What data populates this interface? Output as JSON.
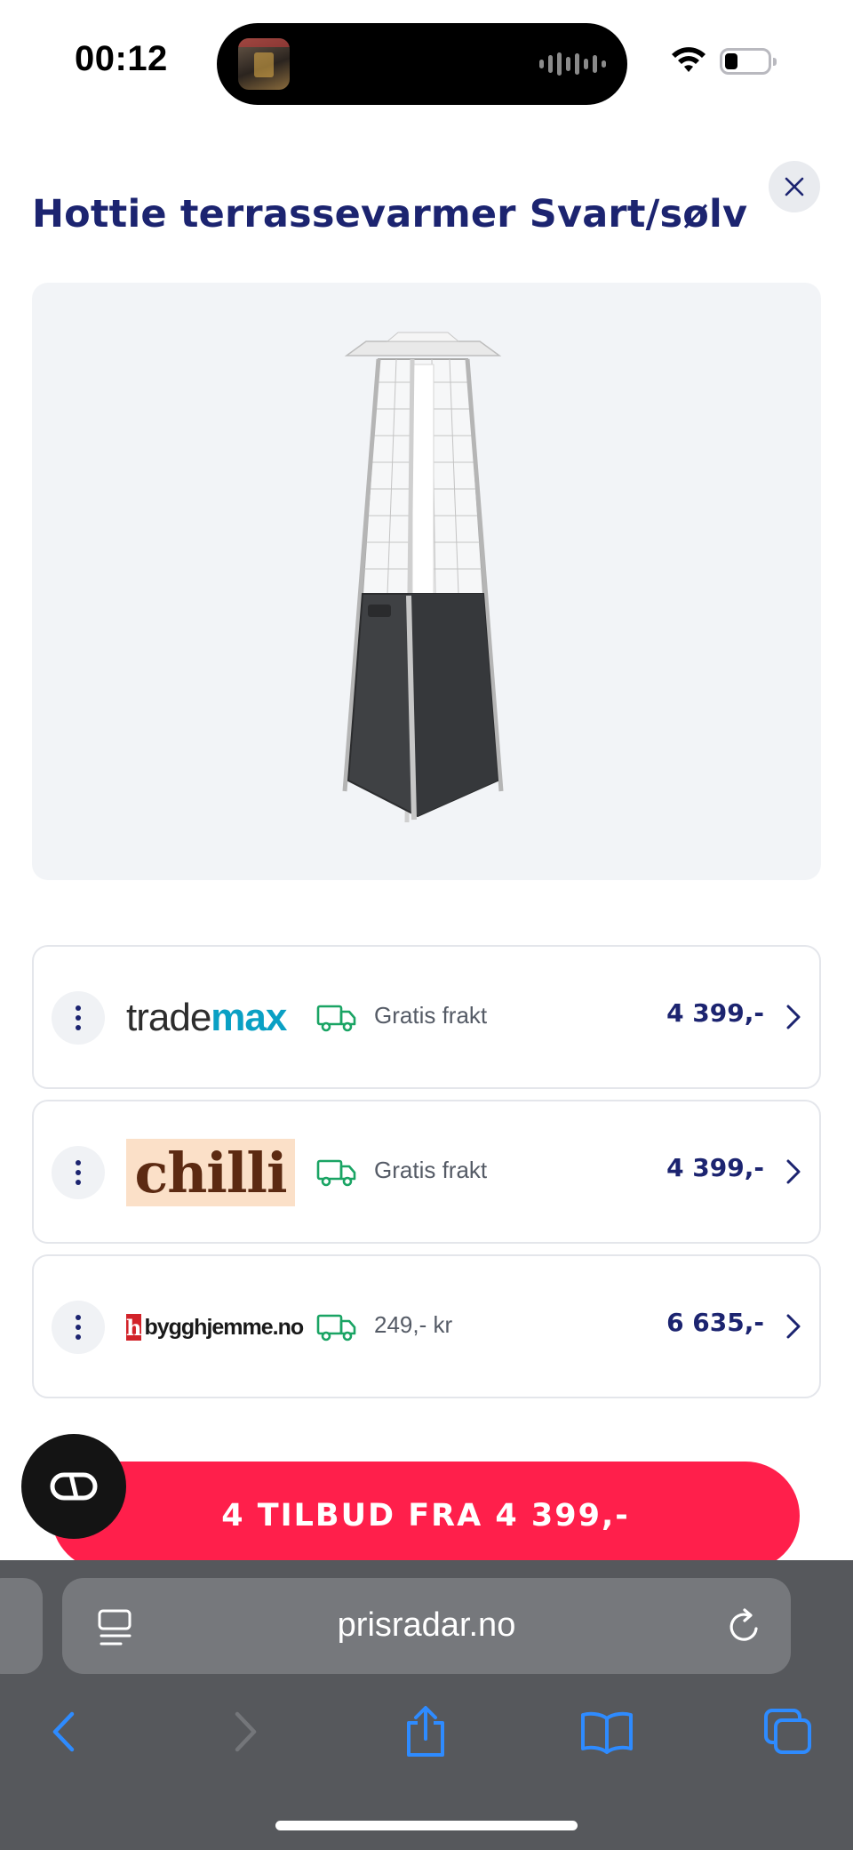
{
  "status_bar": {
    "time": "00:12"
  },
  "product": {
    "title": "Hottie terrassevarmer Svart/sølv",
    "image_icon": "patio-heater-image"
  },
  "offers": [
    {
      "store": "trademax",
      "logo_parts": [
        "trade",
        "max"
      ],
      "shipping": "Gratis frakt",
      "price": "4 399,-"
    },
    {
      "store": "chilli",
      "logo_parts": [
        "chilli"
      ],
      "shipping": "Gratis frakt",
      "price": "4 399,-"
    },
    {
      "store": "bygghjemme.no",
      "logo_parts": [
        "h",
        "bygghjemme.no"
      ],
      "shipping": "249,- kr",
      "price": "6 635,-"
    }
  ],
  "cta": {
    "label": "4 TILBUD FRA 4 399,-"
  },
  "browser": {
    "url": "prisradar.no"
  },
  "colors": {
    "brand_navy": "#1c2470",
    "cta_red": "#ff1f4b",
    "shipping_green": "#1aa464",
    "browser_bar": "#56585c",
    "toolbar_blue": "#2e8bff"
  }
}
